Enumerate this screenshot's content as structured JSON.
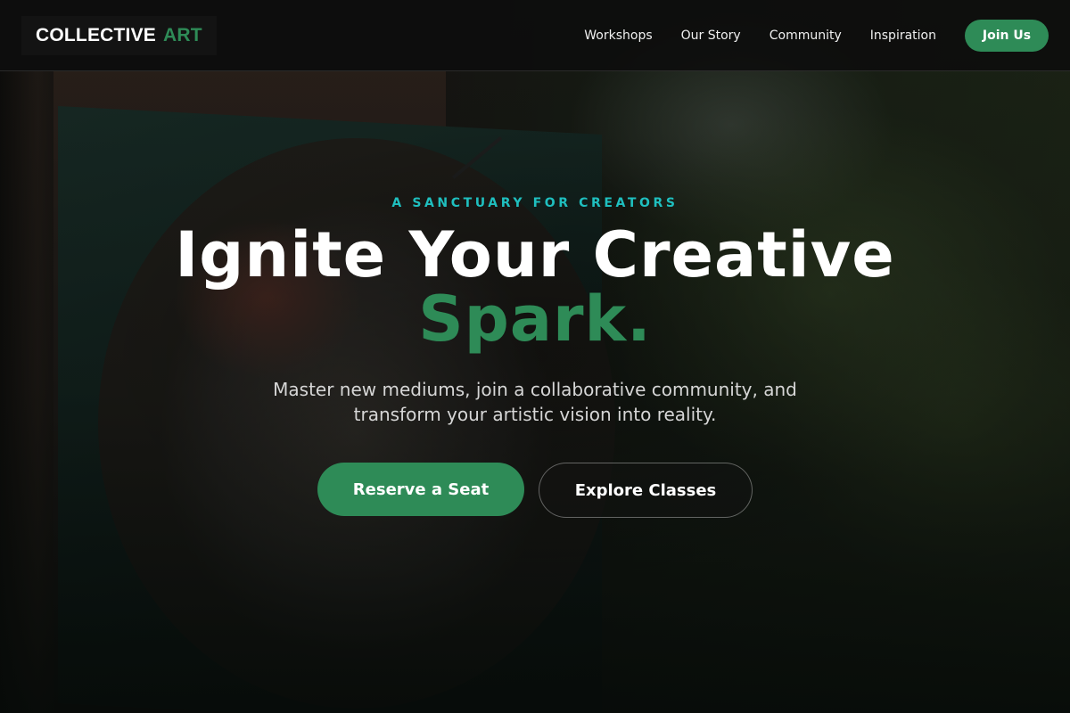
{
  "brand": {
    "word1": "COLLECTIVE",
    "word2": "ART",
    "accent_color": "#2e8b57"
  },
  "nav": {
    "links": [
      {
        "label": "Workshops"
      },
      {
        "label": "Our Story"
      },
      {
        "label": "Community"
      },
      {
        "label": "Inspiration"
      }
    ],
    "cta_label": "Join Us"
  },
  "hero": {
    "eyebrow": "A SANCTUARY FOR CREATORS",
    "headline_line1": "Ignite Your Creative",
    "headline_line2": "Spark.",
    "subtext": "Master new mediums, join a collaborative community, and transform your artistic vision into reality.",
    "primary_cta": "Reserve a Seat",
    "secondary_cta": "Explore Classes",
    "eyebrow_color": "#1fbfbf",
    "background_image": "painted-wooden-board-with-foliage"
  }
}
